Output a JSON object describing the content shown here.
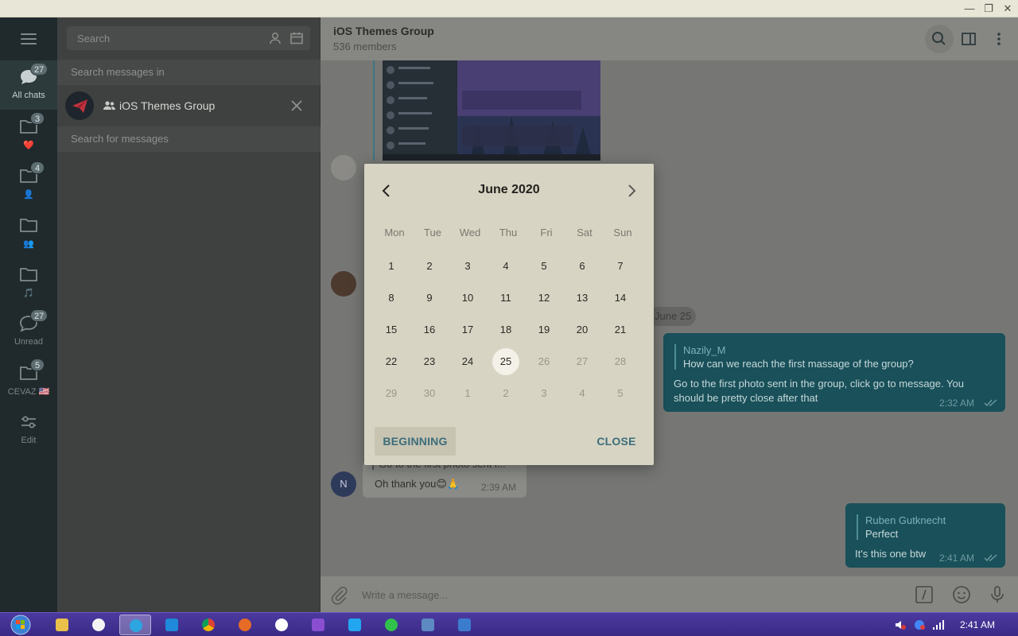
{
  "window": {
    "minimize": "—",
    "restore": "❐",
    "close": "✕"
  },
  "folders": [
    {
      "label": "All chats",
      "badge": "27",
      "icon": "chat-bubbles-icon"
    },
    {
      "label": "❤️",
      "badge": "3",
      "icon": "folder-icon"
    },
    {
      "label": "👤",
      "badge": "4",
      "icon": "folder-icon"
    },
    {
      "label": "👥",
      "badge": "",
      "icon": "folder-icon"
    },
    {
      "label": "🎵",
      "badge": "",
      "icon": "folder-icon"
    },
    {
      "label": "Unread",
      "badge": "27",
      "icon": "chat-bubble-icon"
    },
    {
      "label": "CEVAZ 🇺🇸",
      "badge": "5",
      "icon": "folder-icon"
    },
    {
      "label": "Edit",
      "badge": "",
      "icon": "sliders-icon"
    }
  ],
  "search": {
    "placeholder": "Search",
    "messages_in": "Search messages in",
    "group_name": "iOS Themes Group",
    "for_messages": "Search for messages"
  },
  "chat": {
    "title": "iOS Themes Group",
    "members": "536 members",
    "date_pill": "June 25",
    "outgoing": [
      {
        "reply_name": "Nazily_M",
        "reply_text": "How can we reach the first massage of the group?",
        "text": "Go to the first photo sent in the group, click go to message. You should be pretty close after that",
        "time": "2:32 AM"
      },
      {
        "reply_name": "Ruben Gutknecht",
        "reply_text": "Perfect",
        "text": "It's this one btw",
        "time": "2:41 AM"
      }
    ],
    "incoming": {
      "avatar_letter": "N",
      "reply_partial": "Go to the first photo sent i...",
      "text": "Oh thank you😊🙏",
      "time": "2:39 AM"
    },
    "composer_placeholder": "Write a message..."
  },
  "calendar": {
    "month_title": "June 2020",
    "weekdays": [
      "Mon",
      "Tue",
      "Wed",
      "Thu",
      "Fri",
      "Sat",
      "Sun"
    ],
    "weeks": [
      [
        "1",
        "2",
        "3",
        "4",
        "5",
        "6",
        "7"
      ],
      [
        "8",
        "9",
        "10",
        "11",
        "12",
        "13",
        "14"
      ],
      [
        "15",
        "16",
        "17",
        "18",
        "19",
        "20",
        "21"
      ],
      [
        "22",
        "23",
        "24",
        "25",
        "26",
        "27",
        "28"
      ],
      [
        "29",
        "30",
        "1",
        "2",
        "3",
        "4",
        "5"
      ]
    ],
    "selected": "25",
    "beginning_label": "BEGINNING",
    "close_label": "CLOSE"
  },
  "taskbar": {
    "clock": "2:41 AM",
    "apps": [
      "file-explorer-icon",
      "itunes-icon",
      "telegram-icon",
      "edge-icon",
      "chrome-icon",
      "firefox-icon",
      "app-icon",
      "visual-studio-icon",
      "vscode-icon",
      "whatsapp-icon",
      "postgres-icon",
      "calendar-app-icon"
    ]
  },
  "colors": {
    "accent": "#3c6d7a",
    "outgoing_bubble": "#19505a",
    "sidebar": "#202a2c"
  }
}
